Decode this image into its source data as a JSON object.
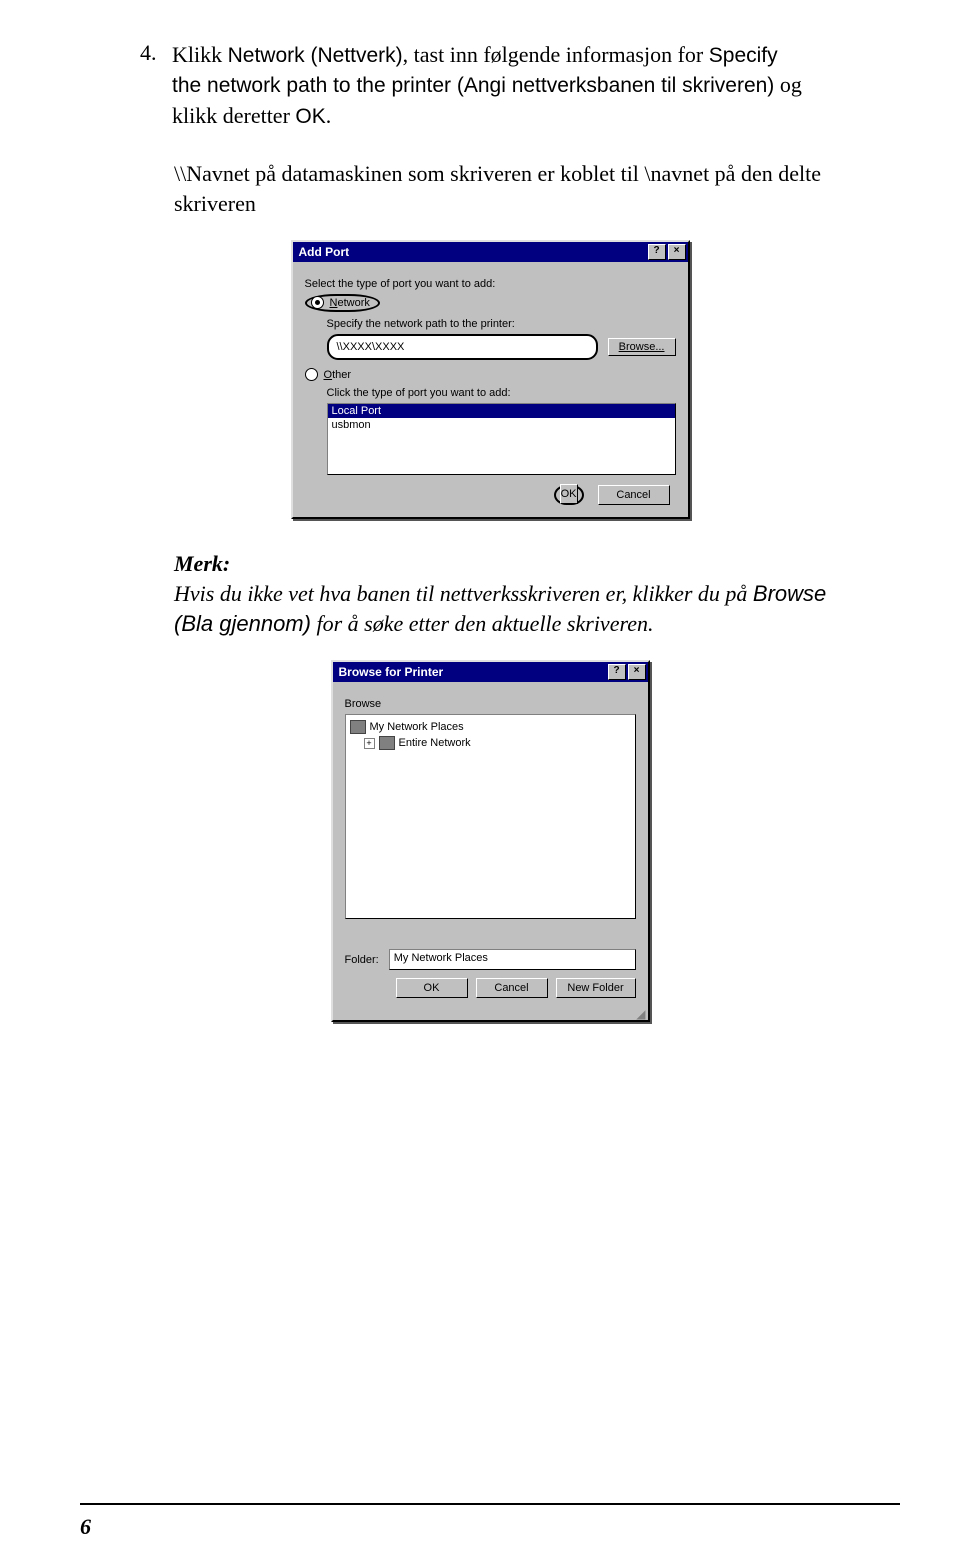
{
  "step": {
    "number": "4.",
    "line1a": "Klikk ",
    "line1b_sans": "Network (Nettverk)",
    "line1c": ", tast inn følgende informasjon for ",
    "line1d_sans": "Specify the network path to the printer (Angi nettverksbanen til skriveren)",
    "line1e": " og klikk deretter ",
    "line1f_sans": "OK",
    "line1g": "."
  },
  "path_text": "\\\\Navnet på datamaskinen som skriveren er koblet til \\navnet på den delte skriveren",
  "dialog1": {
    "title": "Add Port",
    "help_btn": "?",
    "close_btn": "×",
    "select_label": "Select the type of port you want to add:",
    "radio_network": "Network",
    "specify_label": "Specify the network path to the printer:",
    "path_value": "\\\\XXXX\\XXXX",
    "browse_btn": "Browse...",
    "radio_other": "Other",
    "click_label": "Click the type of port you want to add:",
    "list_sel": "Local Port",
    "list_item": "usbmon",
    "ok_btn": "OK",
    "cancel_btn": "Cancel"
  },
  "note": {
    "label": "Merk:",
    "part1": "Hvis du ikke vet hva banen til nettverksskriveren er, klikker du på ",
    "part2_sans": "Browse (Bla gjennom)",
    "part3": " for å søke etter den aktuelle skriveren."
  },
  "dialog2": {
    "title": "Browse for Printer",
    "help_btn": "?",
    "close_btn": "×",
    "browse_label": "Browse",
    "tree_item1": "My Network Places",
    "tree_item2": "Entire Network",
    "expander": "+",
    "folder_label": "Folder:",
    "folder_value": "My Network Places",
    "ok_btn": "OK",
    "cancel_btn": "Cancel",
    "newfolder_btn": "New Folder"
  },
  "page_number": "6"
}
